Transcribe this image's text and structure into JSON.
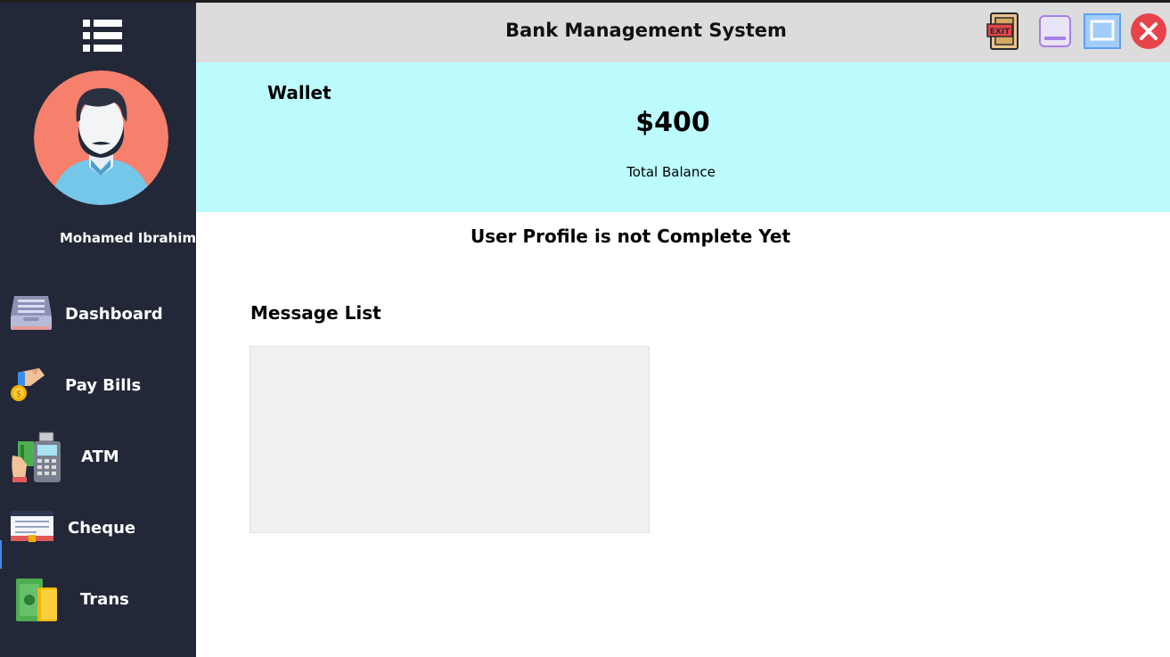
{
  "window": {
    "title": "Bank Management System"
  },
  "user": {
    "name": "Mohamed Ibrahim"
  },
  "sidebar": {
    "menu_icon": "hamburger-list-icon",
    "items": [
      {
        "label": "Dashboard",
        "icon": "inbox-tray-icon"
      },
      {
        "label": "Pay Bills",
        "icon": "hand-coin-icon"
      },
      {
        "label": "ATM",
        "icon": "atm-card-terminal-icon"
      },
      {
        "label": "Cheque",
        "icon": "cheque-icon"
      },
      {
        "label": "Trans",
        "icon": "cash-wallet-icon"
      }
    ]
  },
  "titlebar_buttons": [
    {
      "name": "exit",
      "icon": "exit-sign-icon"
    },
    {
      "name": "minimize",
      "icon": "minimize-icon"
    },
    {
      "name": "maximize",
      "icon": "maximize-icon"
    },
    {
      "name": "close",
      "icon": "close-circle-icon"
    }
  ],
  "wallet": {
    "title": "Wallet",
    "balance": "$400",
    "balance_label": "Total Balance"
  },
  "profile_status": "User Profile is not Complete Yet",
  "messages": {
    "title": "Message List",
    "items": []
  },
  "colors": {
    "sidebar_bg": "#232838",
    "titlebar_bg": "#dcdcdc",
    "wallet_bg": "#bdfcfe",
    "close_red": "#e8434a",
    "avatar_bg": "#f6806b"
  }
}
